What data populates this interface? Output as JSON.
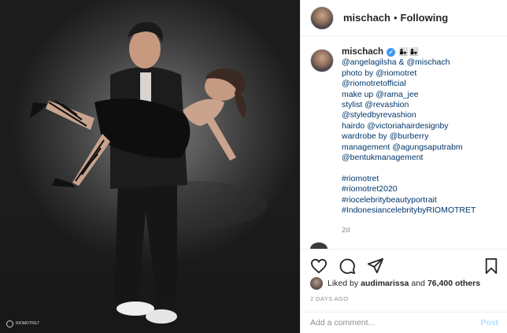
{
  "post": {
    "image_alt": "Portrait of a man in a black leather jacket carrying a woman in a black dress with lace-up heels",
    "watermark_text": "RIOMOTRET"
  },
  "header": {
    "username": "mischach",
    "separator": "•",
    "follow_label": "Following"
  },
  "caption": {
    "username": "mischach",
    "emoji": "👩‍👧👩‍👧",
    "lines": [
      {
        "text": "@angelagilsha & @mischach",
        "type": "tag"
      },
      {
        "text": "photo by @riomotret",
        "type": "mixed"
      },
      {
        "text": "@riomotretofficial",
        "type": "tag"
      },
      {
        "text": "make up @rama_jee",
        "type": "mixed"
      },
      {
        "text": "stylist @revashion",
        "type": "mixed"
      },
      {
        "text": "@styledbyrevashion",
        "type": "tag"
      },
      {
        "text": "hairdo @victoriahairdesignby",
        "type": "mixed"
      },
      {
        "text": "wardrobe by @burberry",
        "type": "mixed"
      },
      {
        "text": "management @agungsaputrabm",
        "type": "mixed"
      },
      {
        "text": "@bentukmanagement",
        "type": "tag"
      },
      {
        "text": "",
        "type": "blank"
      },
      {
        "text": "#riomotret",
        "type": "tag"
      },
      {
        "text": "#riomotret2020",
        "type": "tag"
      },
      {
        "text": "#riocelebritybeautyportrait",
        "type": "tag"
      },
      {
        "text": "#IndonesiancelebritybyRIOMOTRET",
        "type": "tag"
      }
    ],
    "time_ago": "2d"
  },
  "actions": {
    "like_icon": "heart-icon",
    "comment_icon": "comment-icon",
    "share_icon": "share-icon",
    "save_icon": "bookmark-icon"
  },
  "likes": {
    "prefix": "Liked by",
    "user": "audimarissa",
    "and": "and",
    "count": "76,400 others"
  },
  "posted": "2 DAYS AGO",
  "comment": {
    "placeholder": "Add a comment...",
    "post_label": "Post"
  },
  "colors": {
    "link": "#00376b",
    "verified": "#3897f0",
    "post_disabled": "#b2dffc",
    "muted": "#8e8e8e",
    "border": "#efefef"
  }
}
